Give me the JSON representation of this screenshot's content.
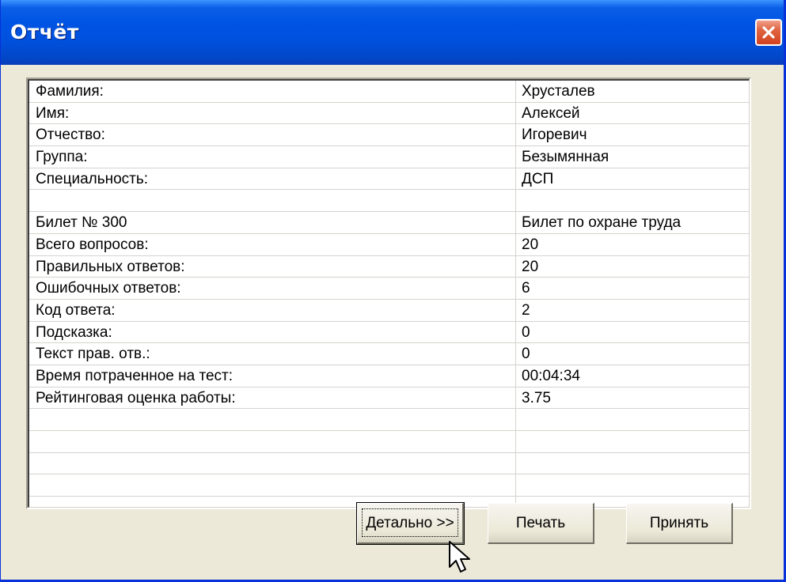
{
  "window": {
    "title": "Отчёт"
  },
  "report": {
    "rows": [
      {
        "label": "Фамилия:",
        "value": "Хрусталев"
      },
      {
        "label": "Имя:",
        "value": "Алексей"
      },
      {
        "label": "Отчество:",
        "value": "Игоревич"
      },
      {
        "label": "Группа:",
        "value": "Безымянная"
      },
      {
        "label": "Специальность:",
        "value": "ДСП"
      },
      {
        "label": "",
        "value": ""
      },
      {
        "label": "Билет № 300",
        "value": "Билет по охране труда"
      },
      {
        "label": "Всего вопросов:",
        "value": "20"
      },
      {
        "label": "Правильных ответов:",
        "value": "20"
      },
      {
        "label": "Ошибочных ответов:",
        "value": "6"
      },
      {
        "label": "Код ответа:",
        "value": "2"
      },
      {
        "label": "Подсказка:",
        "value": "0"
      },
      {
        "label": "Текст прав. отв.:",
        "value": "0"
      },
      {
        "label": "Время потраченное на тест:",
        "value": "00:04:34"
      },
      {
        "label": "Рейтинговая оценка работы:",
        "value": "3.75"
      },
      {
        "label": "",
        "value": ""
      },
      {
        "label": "",
        "value": ""
      },
      {
        "label": "",
        "value": ""
      },
      {
        "label": "",
        "value": ""
      }
    ]
  },
  "buttons": {
    "details": "Детально >>",
    "print": "Печать",
    "accept": "Принять"
  },
  "icons": {
    "close": "close-icon",
    "cursor": "mouse-pointer-icon"
  },
  "colors": {
    "titlebar": "#0054e3",
    "close_button": "#e06440",
    "dialog_face": "#ece9d8"
  }
}
